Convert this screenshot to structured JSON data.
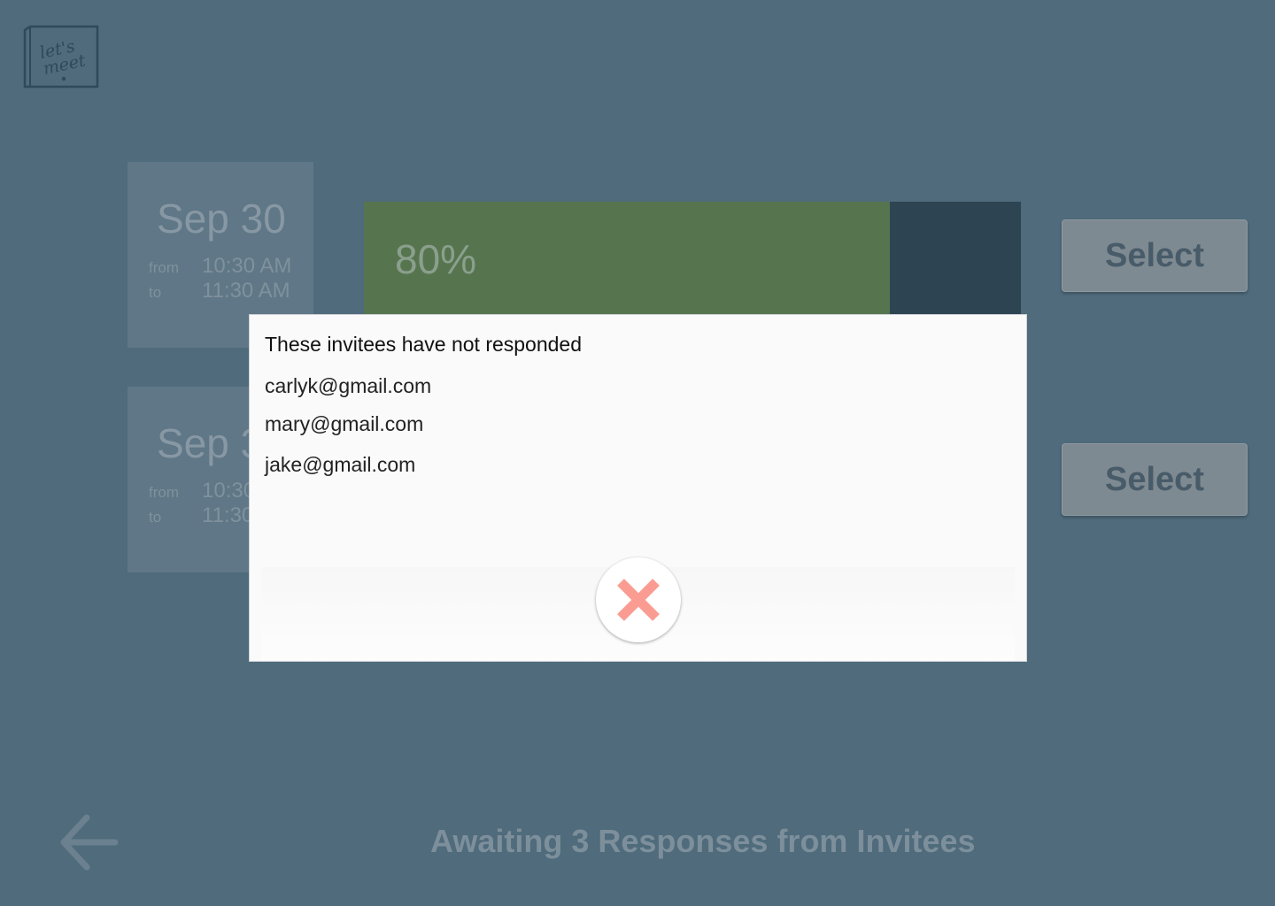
{
  "app": {
    "logo_text": "let's meet",
    "back_icon": "arrow-left-icon"
  },
  "options": [
    {
      "date": "Sep 30",
      "from_label": "from",
      "from_time": "10:30 AM",
      "to_label": "to",
      "to_time": "11:30 AM",
      "percent_label": "80%",
      "percent_value": 80,
      "select_label": "Select"
    },
    {
      "date": "Sep 3",
      "from_label": "from",
      "from_time": "10:30",
      "to_label": "to",
      "to_time": "11:30",
      "select_label": "Select"
    }
  ],
  "status": {
    "text": "Awaiting 3 Responses from Invitees"
  },
  "modal": {
    "title": "These invitees have not responded",
    "emails": [
      "carlyk@gmail.com",
      "mary@gmail.com",
      "jake@gmail.com"
    ],
    "close_icon": "close-icon"
  },
  "colors": {
    "background": "#4f6b7c",
    "progress_fill": "#56754f",
    "progress_track": "#2d4453",
    "close_icon": "#fb9c92",
    "modal_bg": "#fafafa"
  }
}
